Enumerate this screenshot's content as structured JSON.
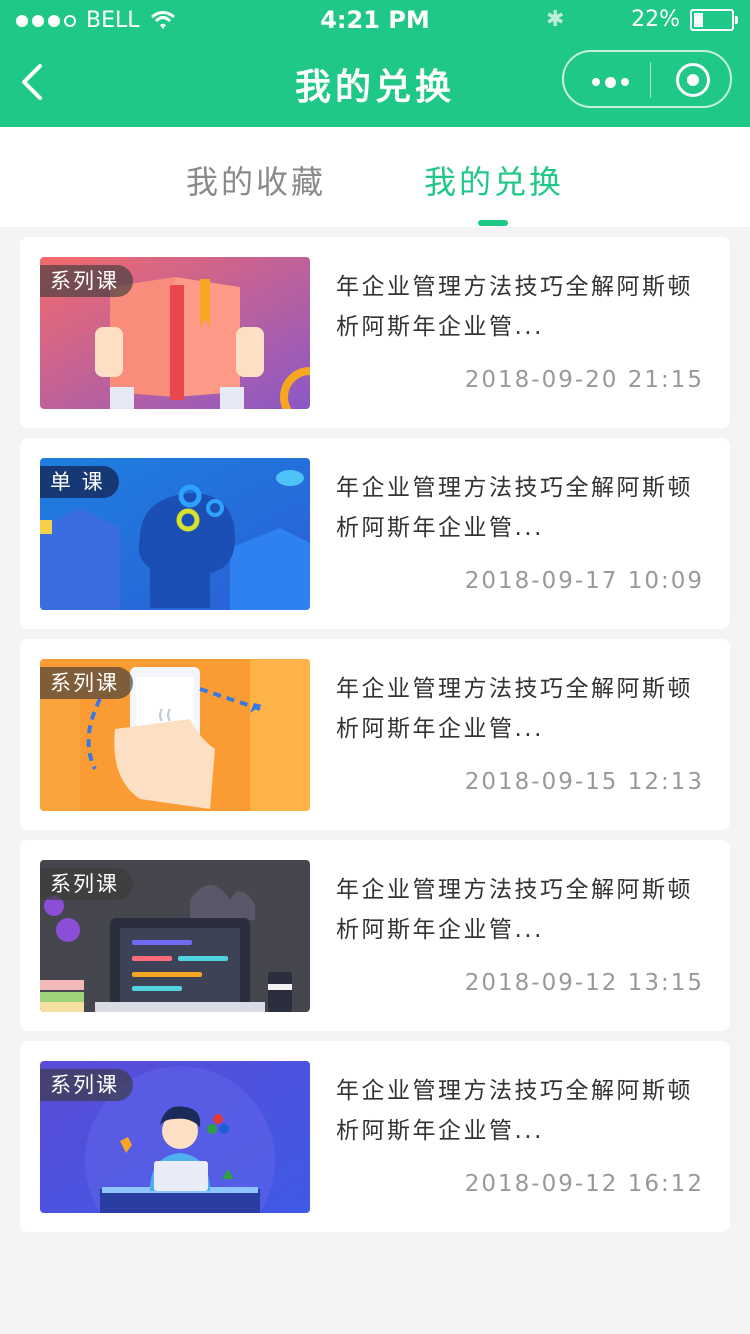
{
  "status_bar": {
    "carrier": "BELL",
    "time": "4:21 PM",
    "battery": "22%",
    "battery_level": 0.22
  },
  "navbar": {
    "title": "我的兑换"
  },
  "tabs": [
    {
      "label": "我的收藏",
      "active": false
    },
    {
      "label": "我的兑换",
      "active": true
    }
  ],
  "items": [
    {
      "badge": "系列课",
      "title": "年企业管理方法技巧全解阿斯顿析阿斯年企业管...",
      "date": "2018-09-20 21:15",
      "thumb": "book-illustration"
    },
    {
      "badge": "单 课",
      "title": "年企业管理方法技巧全解阿斯顿析阿斯年企业管...",
      "date": "2018-09-17 10:09",
      "thumb": "brain-gears-illustration"
    },
    {
      "badge": "系列课",
      "title": "年企业管理方法技巧全解阿斯顿析阿斯年企业管...",
      "date": "2018-09-15 12:13",
      "thumb": "phone-coffee-illustration"
    },
    {
      "badge": "系列课",
      "title": "年企业管理方法技巧全解阿斯顿析阿斯年企业管...",
      "date": "2018-09-12 13:15",
      "thumb": "laptop-code-illustration"
    },
    {
      "badge": "系列课",
      "title": "年企业管理方法技巧全解阿斯顿析阿斯年企业管...",
      "date": "2018-09-12 16:12",
      "thumb": "developer-illustration"
    }
  ],
  "colors": {
    "brand": "#1fc886",
    "background": "#f4f4f4",
    "text_primary": "#333333",
    "text_secondary": "#999999"
  }
}
